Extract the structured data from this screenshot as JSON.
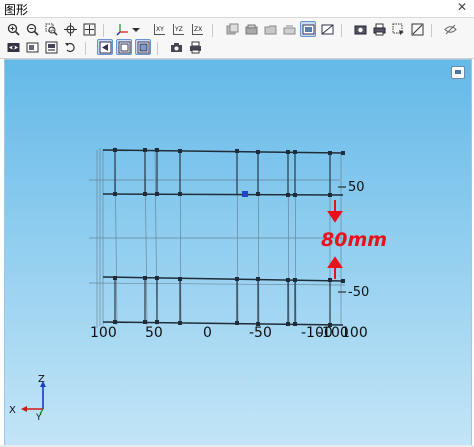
{
  "window": {
    "title": "图形"
  },
  "toolbar": {
    "row1": [
      "zoom-in-icon",
      "zoom-out-icon",
      "zoom-window-icon",
      "pan-icon",
      "zoom-fit-icon",
      "axis-dropdown-icon",
      "view-xy-icon",
      "view-yz-icon",
      "view-zx-icon",
      "layer-1-icon",
      "layer-2-icon",
      "layer-3-icon",
      "layer-4-icon",
      "view-mode-icon",
      "hide-icon",
      "save-image-icon",
      "print-icon",
      "select-icon",
      "snap-icon",
      "eye-off-icon"
    ],
    "row2": [
      "eye-icon",
      "display-icon",
      "render-icon",
      "undo-icon",
      "shade-icon",
      "wireframe-icon",
      "transparent-icon",
      "camera-icon",
      "printer-icon"
    ],
    "view_labels": {
      "xy": "XY",
      "yz": "YZ",
      "zx": "ZX"
    }
  },
  "viewport": {
    "right_ticks": [
      "50",
      "-50"
    ],
    "bottom_ticks": [
      "100",
      "50",
      "0",
      "-50",
      "-100",
      "-100",
      "100"
    ],
    "annotation": "80mm",
    "annotation_color": "#e8121b",
    "triad": {
      "z": "Z",
      "x": "X",
      "y": "Y"
    },
    "node_color": "#2244cc"
  }
}
